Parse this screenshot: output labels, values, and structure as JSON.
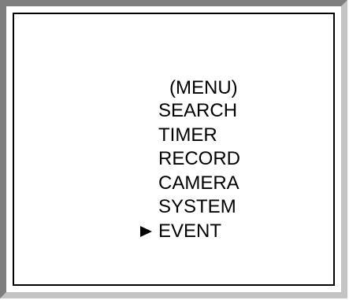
{
  "menu": {
    "title": "(MENU)",
    "items": [
      {
        "label": "SEARCH",
        "selected": false
      },
      {
        "label": "TIMER",
        "selected": false
      },
      {
        "label": "RECORD",
        "selected": false
      },
      {
        "label": "CAMERA",
        "selected": false
      },
      {
        "label": "SYSTEM",
        "selected": false
      },
      {
        "label": "EVENT",
        "selected": true
      }
    ],
    "pointer_icon": "triangle-right-icon"
  },
  "colors": {
    "frame_dark": "#7f7f7f",
    "frame_light": "#c4c4c4",
    "background": "#ffffff",
    "text": "#000000"
  }
}
